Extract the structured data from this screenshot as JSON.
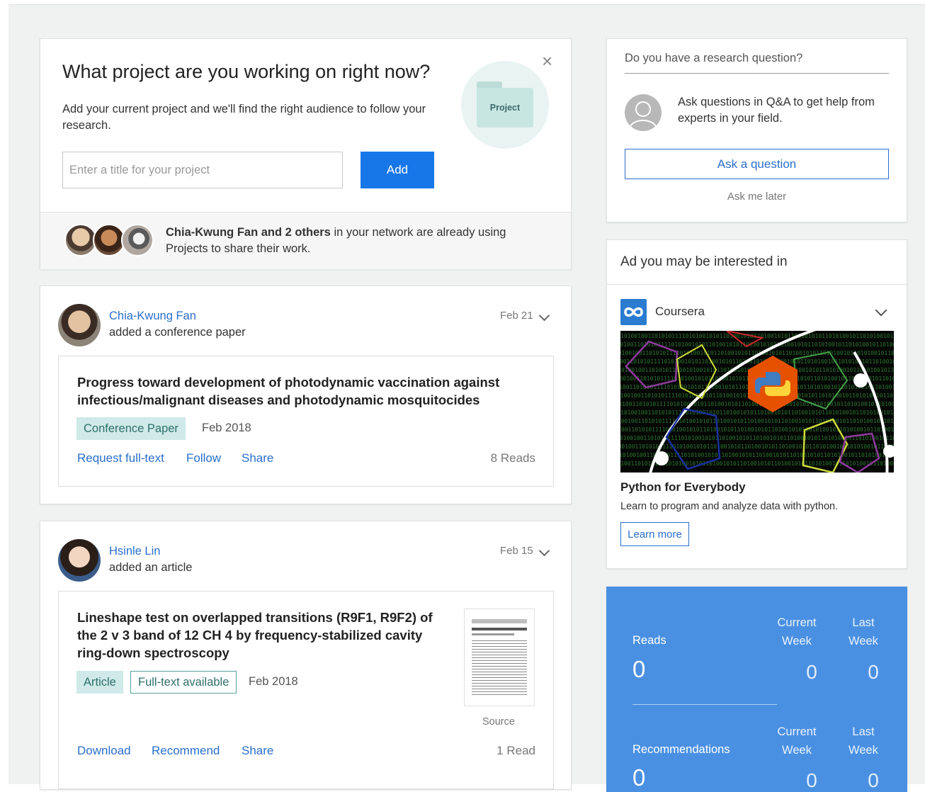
{
  "project_card": {
    "title": "What project are you working on right now?",
    "description": "Add your current project and we'll find the right audience to follow your research.",
    "input_placeholder": "Enter a title for your project",
    "add_label": "Add",
    "close_symbol": "×",
    "folder_label": "Project",
    "network_bold": "Chia-Kwung Fan and 2 others",
    "network_rest": " in your network are already using Projects to share their work."
  },
  "feed": [
    {
      "author": "Chia-Kwung Fan",
      "action": "added a conference paper",
      "date": "Feb 21",
      "title": "Progress toward development of photodynamic vaccination against infectious/malignant diseases and photodynamic mosquitocides",
      "type_tag": "Conference Paper",
      "pub_date": "Feb 2018",
      "actions": [
        "Request full-text",
        "Follow",
        "Share"
      ],
      "reads": "8 Reads"
    },
    {
      "author": "Hsinle Lin",
      "action": "added an article",
      "date": "Feb 15",
      "title": "Lineshape test on overlapped transitions (R9F1, R9F2) of the 2 v 3 band of 12 CH 4 by frequency-stabilized cavity ring-down spectroscopy",
      "type_tag": "Article",
      "fulltext_tag": "Full-text available",
      "pub_date": "Feb 2018",
      "source_label": "Source",
      "actions": [
        "Download",
        "Recommend",
        "Share"
      ],
      "reads": "1 Read"
    }
  ],
  "question_card": {
    "field": "Do you have a research question?",
    "text": "Ask questions in Q&A to get help from experts in your field.",
    "button": "Ask a question",
    "later": "Ask me later"
  },
  "ad_card": {
    "header": "Ad you may be interested in",
    "brand": "Coursera",
    "title": "Python for Everybody",
    "description": "Learn to program and analyze data with python.",
    "button": "Learn more",
    "binary_text": "10100100110101011110101001010110100101011010010101101001010110101001011010100101101001010101101010010110"
  },
  "stats": {
    "reads_label": "Reads",
    "reads_total": "0",
    "reads_current": "0",
    "reads_last": "0",
    "current_week": "Current Week",
    "last_week": "Last Week",
    "rec_label": "Recommendations",
    "rec_total": "0",
    "rec_current": "0",
    "rec_last": "0"
  }
}
